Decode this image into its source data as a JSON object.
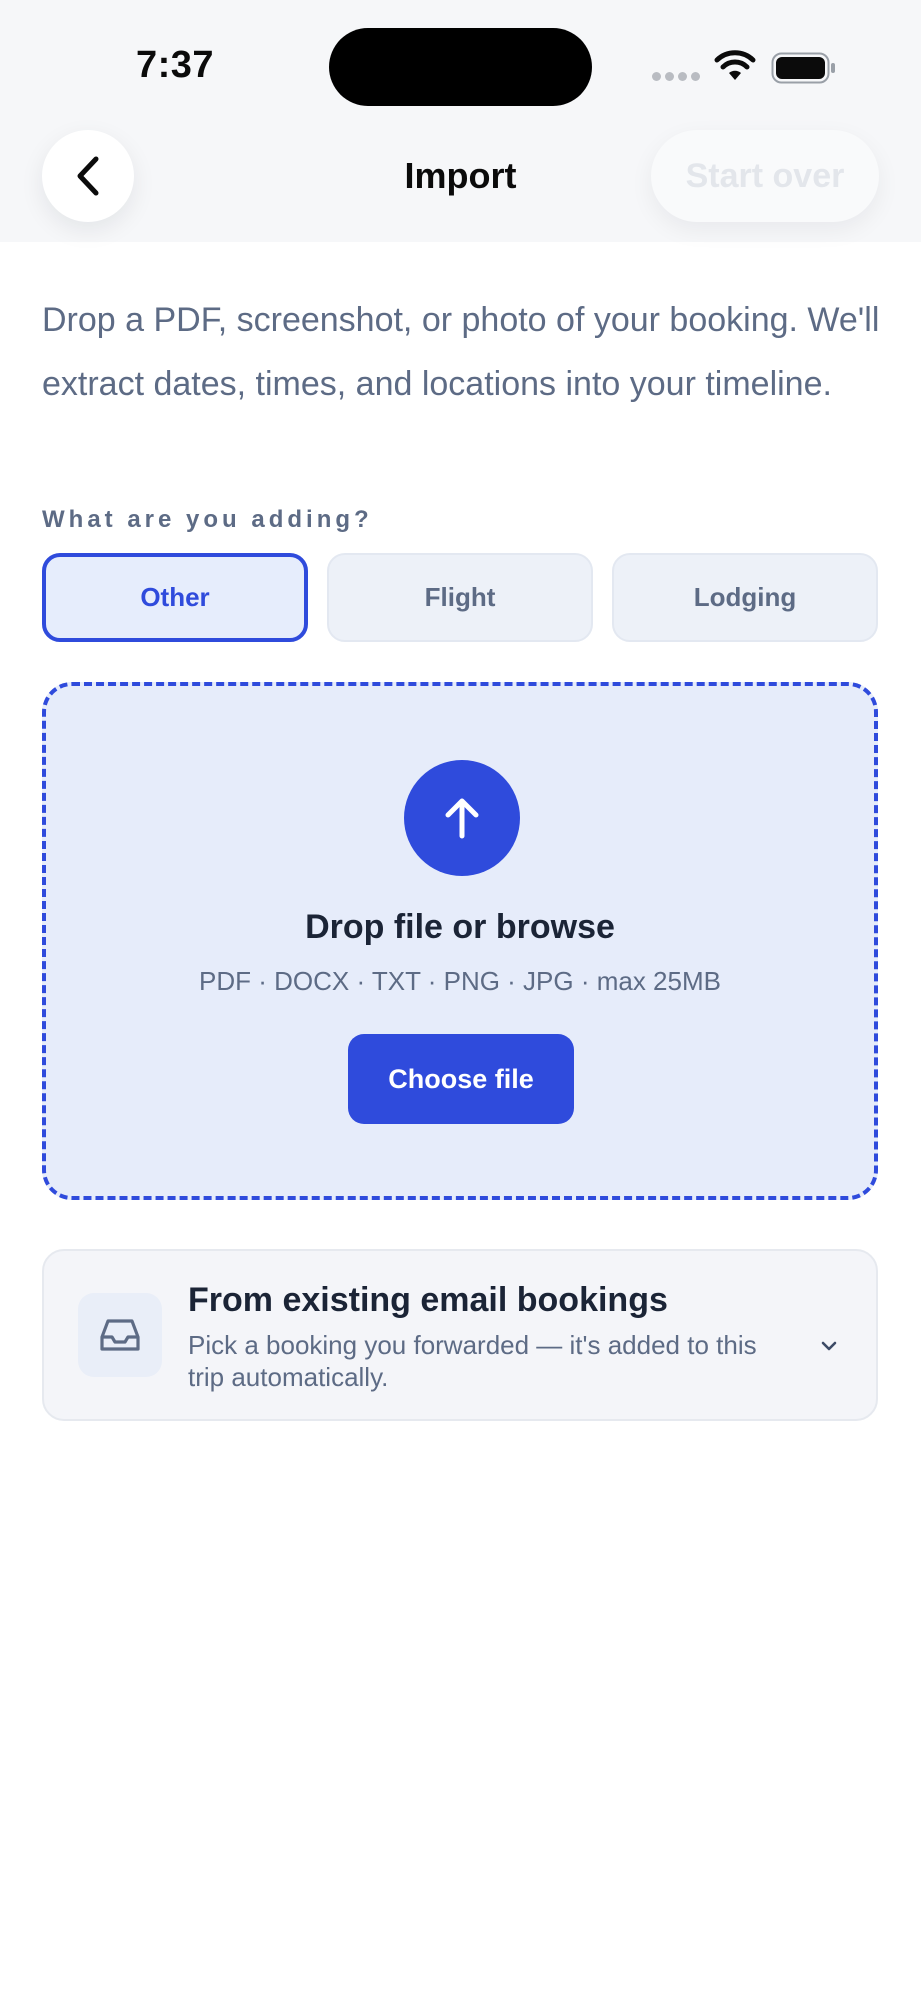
{
  "status_bar": {
    "time": "7:37"
  },
  "nav": {
    "title": "Import",
    "start_over_label": "Start over"
  },
  "intro_text": "Drop a PDF, screenshot, or photo of your booking. We'll extract dates, times, and locations into your timeline.",
  "type_section": {
    "label": "What are you adding?",
    "options": [
      {
        "label": "Other",
        "selected": true
      },
      {
        "label": "Flight",
        "selected": false
      },
      {
        "label": "Lodging",
        "selected": false
      }
    ]
  },
  "dropzone": {
    "icon": "arrow-up-icon",
    "title": "Drop file or browse",
    "formats": "PDF · DOCX · TXT · PNG · JPG · max 25MB",
    "button_label": "Choose file"
  },
  "email_import": {
    "icon": "inbox-icon",
    "title": "From existing email bookings",
    "subtitle": "Pick a booking you forwarded — it's added to this trip automatically."
  },
  "colors": {
    "accent": "#2f4bdc",
    "dropzone_bg": "#e6ecfa",
    "muted_text": "#5d6b85"
  }
}
